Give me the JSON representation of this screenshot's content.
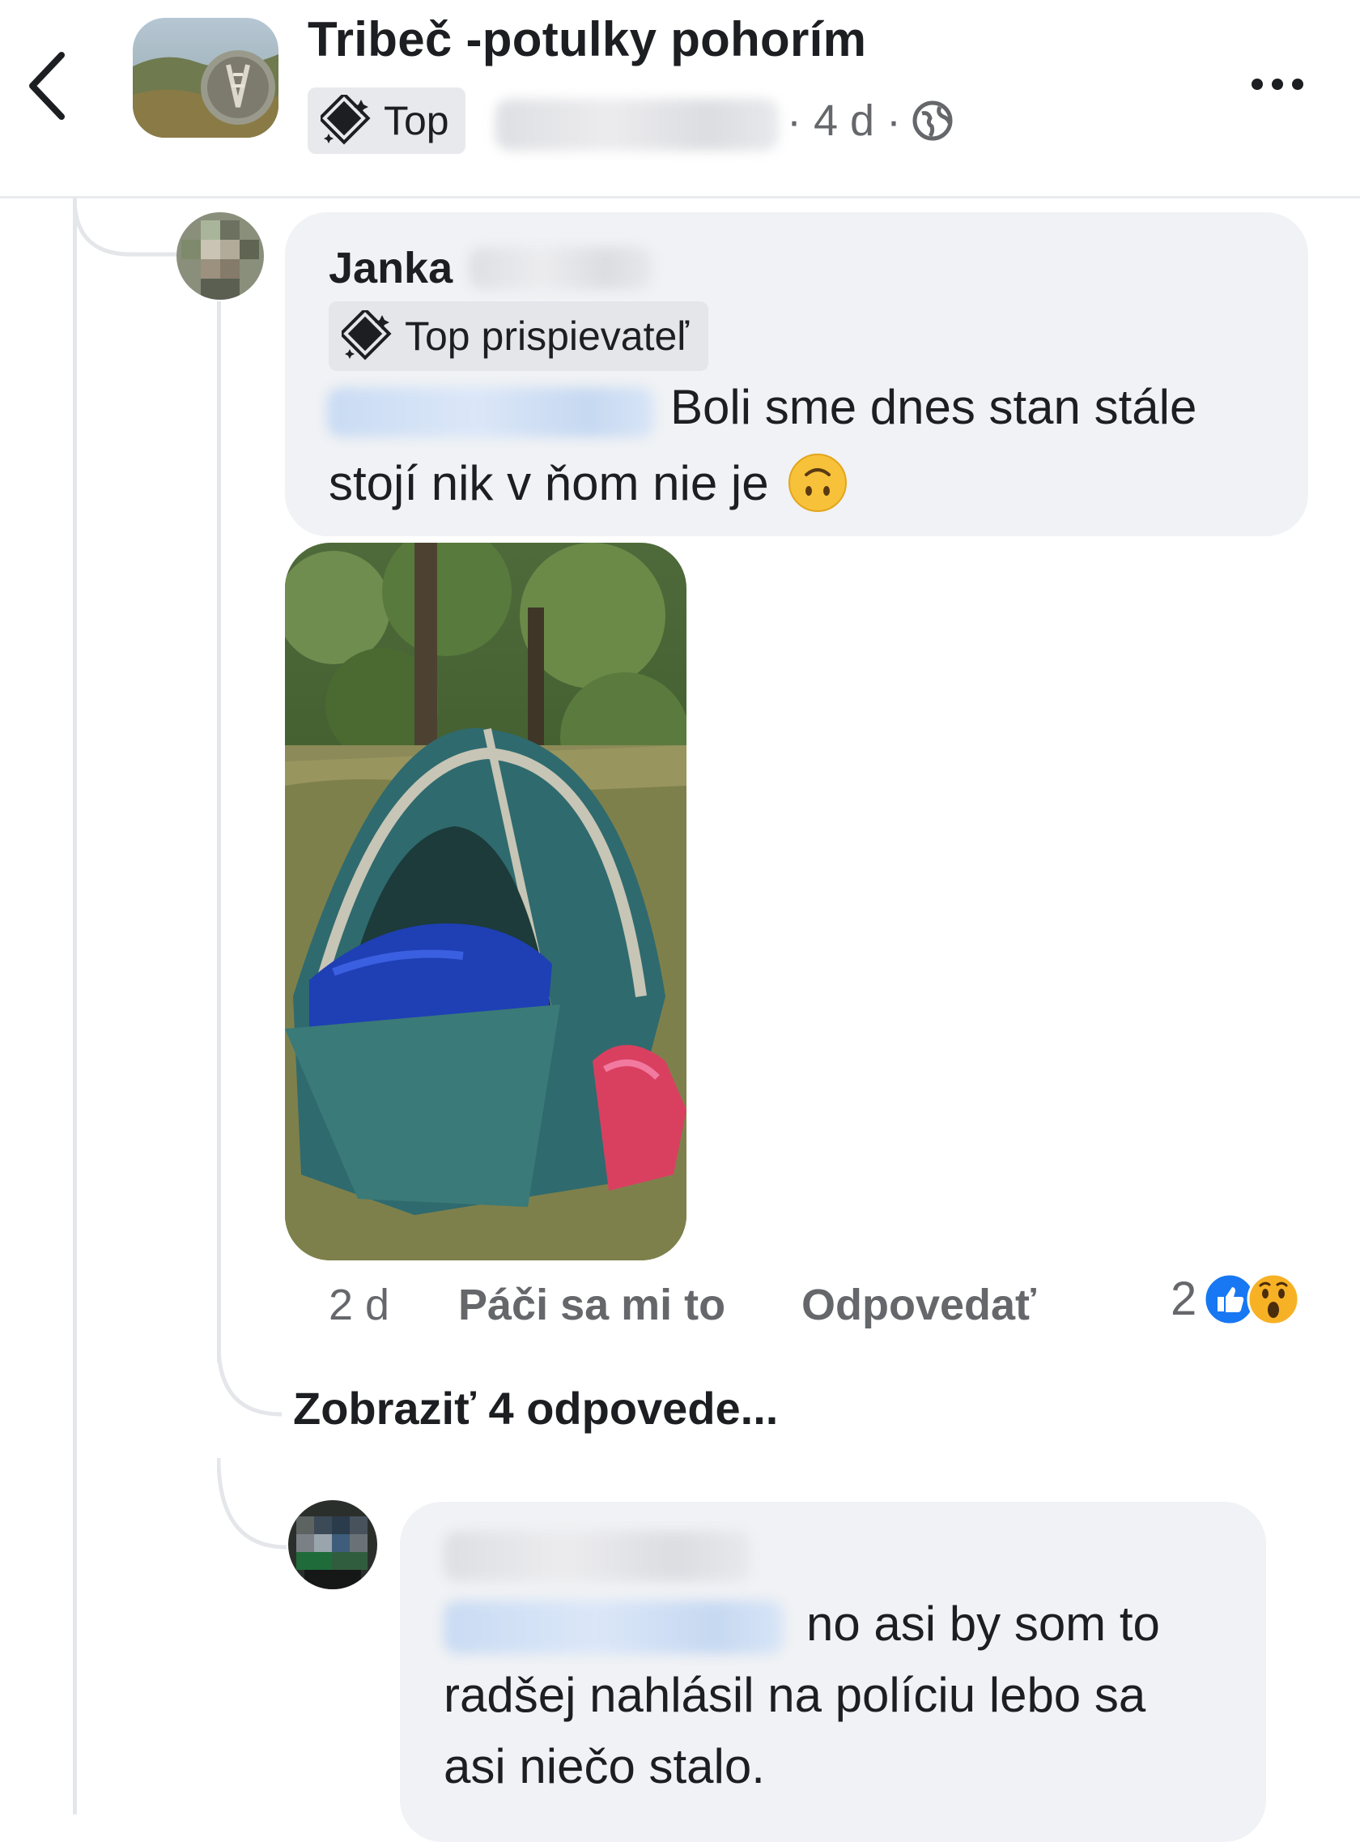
{
  "header": {
    "back_icon": "chevron-left-icon",
    "group_name": "Tribeč -potulky pohorím",
    "badge_label": "Top",
    "badge_icon": "top-contributor-diamond-icon",
    "time": "· 4 d ·",
    "privacy_icon": "globe-icon",
    "more_icon": "more-dots-icon"
  },
  "comment1": {
    "author": "Janka",
    "badge_label": "Top prispievateľ",
    "text_line1": "Boli sme dnes stan stále",
    "text_line2": "stojí nik v ňom nie je",
    "emoji": "🙃",
    "photo_description_icon": "tent-photo",
    "time": "2 d",
    "like_label": "Páči sa mi to",
    "reply_label": "Odpovedať",
    "reaction_count": "2",
    "reaction_icons": [
      "like-reaction-icon",
      "wow-reaction-icon"
    ],
    "like_color": "#1877f2"
  },
  "view_replies_label": "Zobraziť 4 odpovede...",
  "comment2": {
    "text_line1": "no asi by som to",
    "text_line2": "radšej nahlásil na políciu lebo sa",
    "text_line3": "asi niečo stalo."
  }
}
